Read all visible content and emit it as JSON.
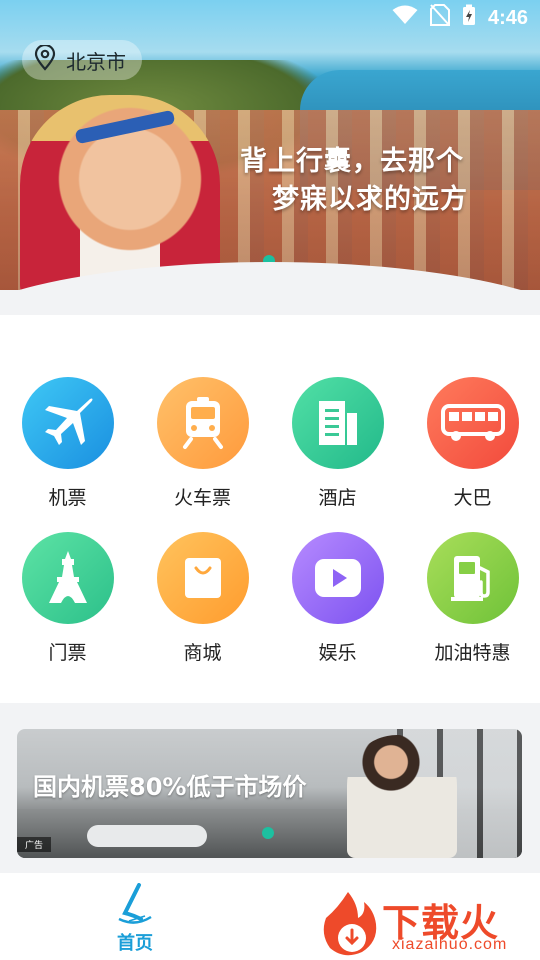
{
  "status_bar": {
    "time": "4:46"
  },
  "location": {
    "city": "北京市"
  },
  "hero": {
    "slogan_line1": "背上行囊，去那个",
    "slogan_line2": "梦寐以求的远方"
  },
  "services": [
    {
      "label": "机票",
      "icon": "airplane-icon",
      "color_from": "#3fc8f5",
      "color_to": "#1a8fe0"
    },
    {
      "label": "火车票",
      "icon": "train-icon",
      "color_from": "#ffc16a",
      "color_to": "#ff9a3c"
    },
    {
      "label": "酒店",
      "icon": "building-icon",
      "color_from": "#52e0a6",
      "color_to": "#22b98a"
    },
    {
      "label": "大巴",
      "icon": "bus-icon",
      "color_from": "#ff7b5c",
      "color_to": "#f24a3c"
    },
    {
      "label": "门票",
      "icon": "tower-icon",
      "color_from": "#5de3a5",
      "color_to": "#2cc08a"
    },
    {
      "label": "商城",
      "icon": "shopping-bag-icon",
      "color_from": "#ffc35d",
      "color_to": "#ff9c2e"
    },
    {
      "label": "娱乐",
      "icon": "play-icon",
      "color_from": "#b78bff",
      "color_to": "#7c52f0"
    },
    {
      "label": "加油特惠",
      "icon": "fuel-pump-icon",
      "color_from": "#a9de5a",
      "color_to": "#6fc238"
    }
  ],
  "banner": {
    "text": "国内机票80%低于市场价",
    "ad_tag": "广告"
  },
  "tabbar": {
    "home_label": "首页"
  },
  "watermark": {
    "brand": "下载火",
    "url": "xiazaihuo.com"
  },
  "colors": {
    "accent": "#1a9ed8",
    "indicator": "#1cc0a0",
    "watermark": "#ee4a2a"
  }
}
